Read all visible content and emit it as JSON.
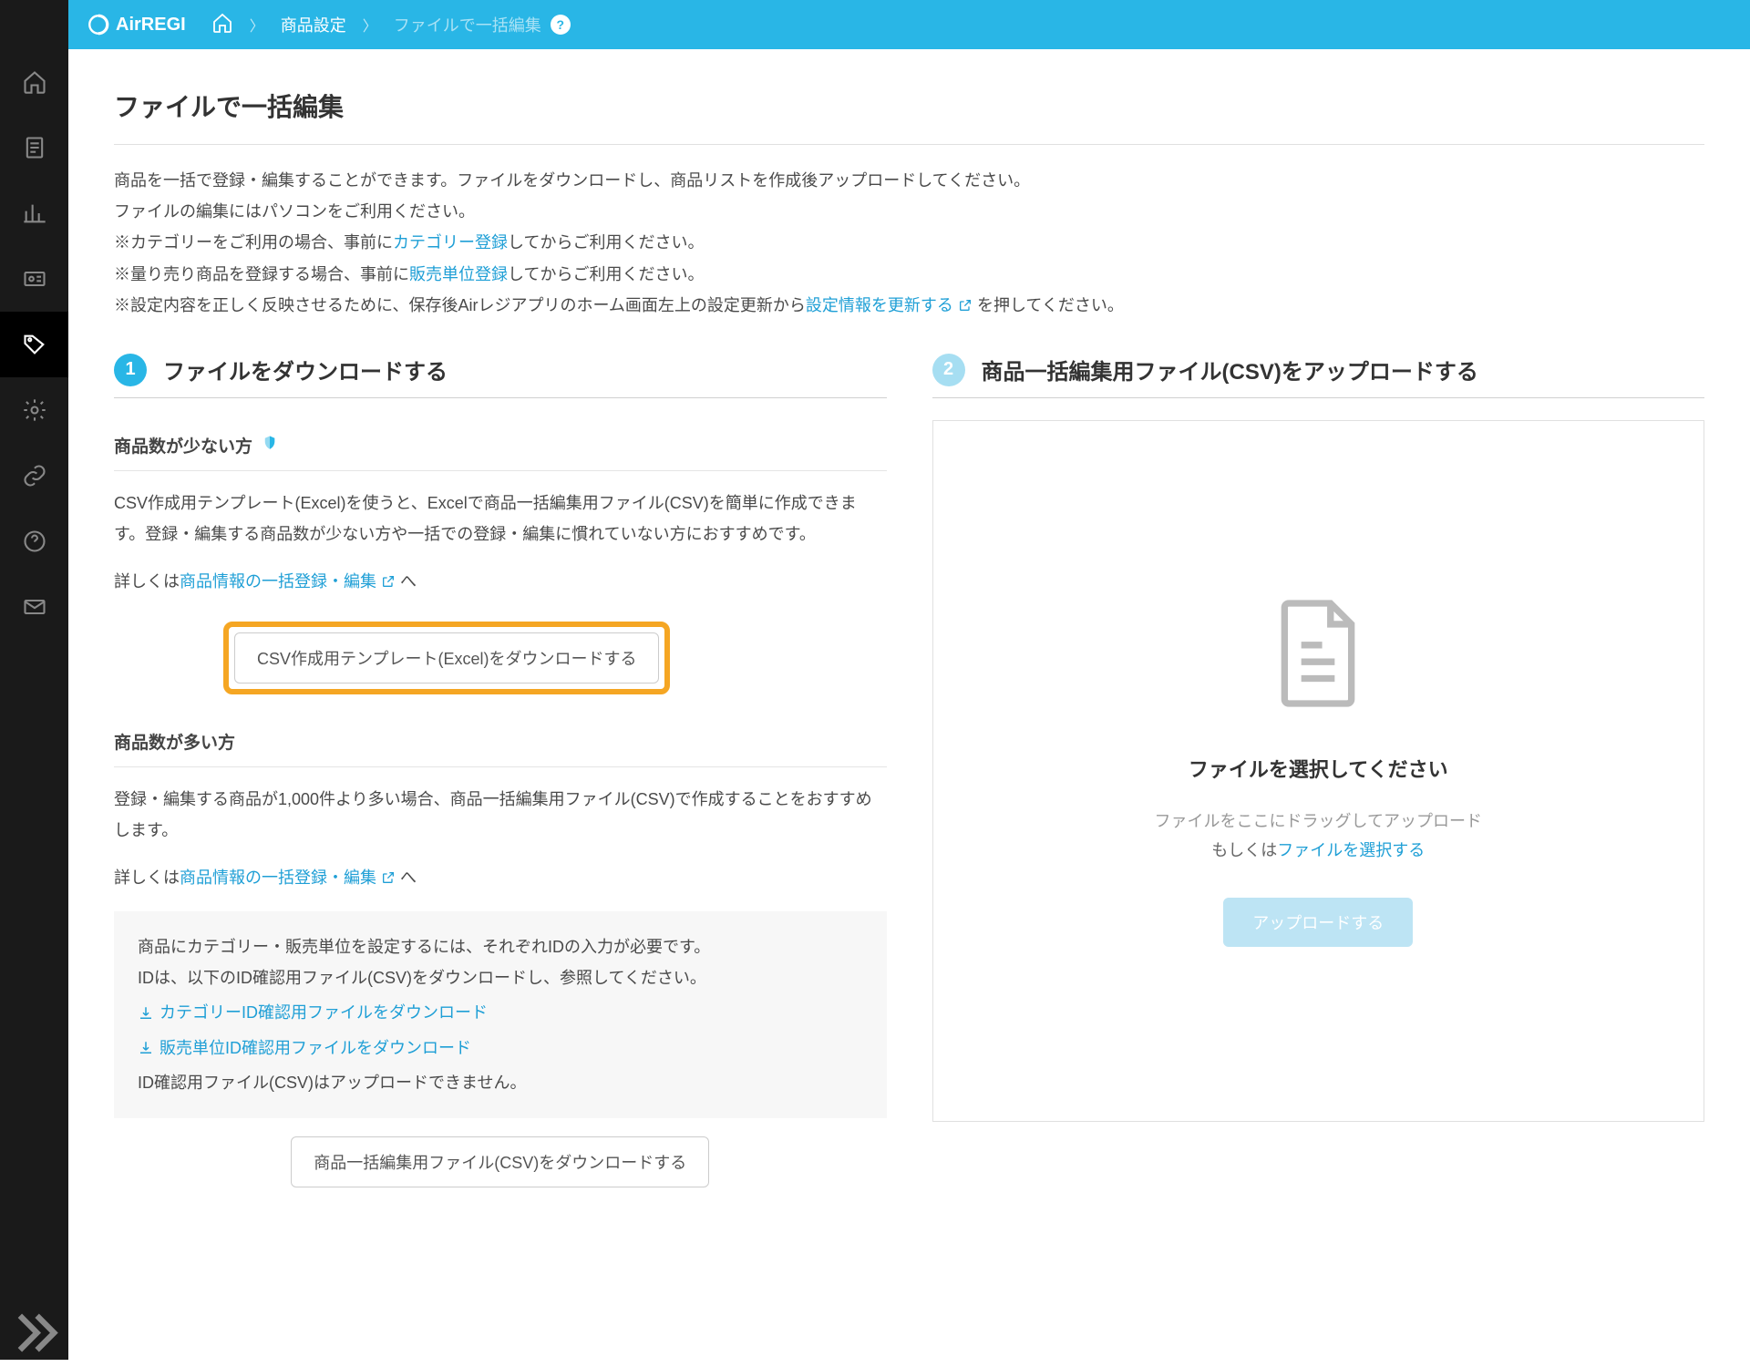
{
  "brand": "AirREGI",
  "breadcrumb": {
    "item1": "商品設定",
    "item2": "ファイルで一括編集",
    "help": "?"
  },
  "page_title": "ファイルで一括編集",
  "intro": {
    "l1": "商品を一括で登録・編集することができます。ファイルをダウンロードし、商品リストを作成後アップロードしてください。",
    "l2": "ファイルの編集にはパソコンをご利用ください。",
    "l3a": "※カテゴリーをご利用の場合、事前に",
    "l3_link": "カテゴリー登録",
    "l3b": "してからご利用ください。",
    "l4a": "※量り売り商品を登録する場合、事前に",
    "l4_link": "販売単位登録",
    "l4b": "してからご利用ください。",
    "l5a": "※設定内容を正しく反映させるために、保存後Airレジアプリのホーム画面左上の設定更新から",
    "l5_link": "設定情報を更新する",
    "l5b": " を押してください。"
  },
  "step1": {
    "num": "1",
    "title": "ファイルをダウンロードする"
  },
  "step2": {
    "num": "2",
    "title": "商品一括編集用ファイル(CSV)をアップロードする"
  },
  "few": {
    "header": "商品数が少ない方",
    "body": "CSV作成用テンプレート(Excel)を使うと、Excelで商品一括編集用ファイル(CSV)を簡単に作成できます。登録・編集する商品数が少ない方や一括での登録・編集に慣れていない方におすすめです。",
    "detail_prefix": "詳しくは",
    "detail_link": "商品情報の一括登録・編集",
    "detail_suffix": " へ",
    "button": "CSV作成用テンプレート(Excel)をダウンロードする"
  },
  "many": {
    "header": "商品数が多い方",
    "body": "登録・編集する商品が1,000件より多い場合、商品一括編集用ファイル(CSV)で作成することをおすすめします。",
    "detail_prefix": "詳しくは",
    "detail_link": "商品情報の一括登録・編集",
    "detail_suffix": " へ",
    "box_l1": "商品にカテゴリー・販売単位を設定するには、それぞれIDの入力が必要です。",
    "box_l2": "IDは、以下のID確認用ファイル(CSV)をダウンロードし、参照してください。",
    "dl1": "カテゴリーID確認用ファイルをダウンロード",
    "dl2": "販売単位ID確認用ファイルをダウンロード",
    "box_l3": "ID確認用ファイル(CSV)はアップロードできません。",
    "button": "商品一括編集用ファイル(CSV)をダウンロードする"
  },
  "upload": {
    "title": "ファイルを選択してください",
    "hint": "ファイルをここにドラッグしてアップロード",
    "or_prefix": "もしくは",
    "select_link": "ファイルを選択する",
    "button": "アップロードする"
  }
}
